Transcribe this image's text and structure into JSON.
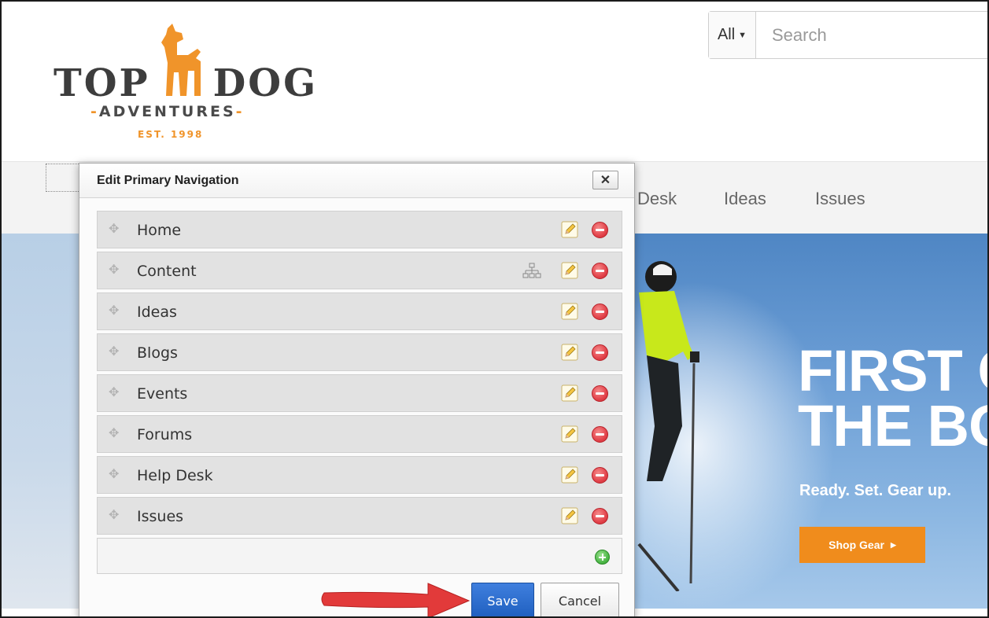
{
  "header": {
    "logo": {
      "word1": "TOP",
      "word2": "DOG",
      "sub": "ADVENTURES",
      "est": "EST. 1998"
    },
    "search": {
      "scope_label": "All",
      "placeholder": "Search"
    }
  },
  "navbar": {
    "items": [
      "Desk",
      "Ideas",
      "Issues"
    ]
  },
  "hero": {
    "title_line1": "FIRST C",
    "title_line2": "THE BO",
    "subtitle": "Ready. Set. Gear up.",
    "button_label": "Shop Gear"
  },
  "dialog": {
    "title": "Edit Primary Navigation",
    "close_label": "✕",
    "items": [
      {
        "label": "Home"
      },
      {
        "label": "Content"
      },
      {
        "label": "Ideas"
      },
      {
        "label": "Blogs"
      },
      {
        "label": "Events"
      },
      {
        "label": "Forums"
      },
      {
        "label": "Help Desk"
      },
      {
        "label": "Issues"
      }
    ],
    "save_label": "Save",
    "cancel_label": "Cancel"
  },
  "colors": {
    "brand_orange": "#f0942a",
    "save_blue": "#2a6ad0",
    "delete_red": "#e3444c",
    "add_green": "#4fb94a",
    "annotation_arrow": "#e23a3a"
  }
}
